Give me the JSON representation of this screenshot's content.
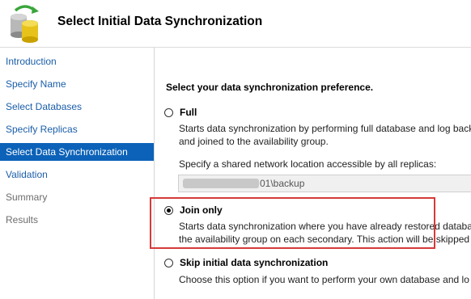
{
  "header": {
    "title": "Select Initial Data Synchronization",
    "icon": "database-sync-icon"
  },
  "sidebar": {
    "items": [
      {
        "label": "Introduction",
        "state": "link"
      },
      {
        "label": "Specify Name",
        "state": "link"
      },
      {
        "label": "Select Databases",
        "state": "link"
      },
      {
        "label": "Specify Replicas",
        "state": "link"
      },
      {
        "label": "Select Data Synchronization",
        "state": "selected"
      },
      {
        "label": "Validation",
        "state": "link"
      },
      {
        "label": "Summary",
        "state": "disabled"
      },
      {
        "label": "Results",
        "state": "disabled"
      }
    ]
  },
  "main": {
    "heading": "Select your data synchronization preference.",
    "options": [
      {
        "label": "Full",
        "checked": false,
        "desc_lines": [
          "Starts data synchronization by performing full database and log back",
          "and joined to the availability group."
        ]
      },
      {
        "label": "Join only",
        "checked": true,
        "desc_lines": [
          "Starts data synchronization where you have already restored database",
          "the availability group on each secondary. This action will be skipped f"
        ]
      },
      {
        "label": "Skip initial data synchronization",
        "checked": false,
        "desc_lines": [
          "Choose this option if you want to perform your own database and lo"
        ]
      }
    ],
    "network_location_label": "Specify a shared network location accessible by all replicas:",
    "network_location_value": "01\\backup"
  },
  "colors": {
    "selected_bg": "#0c62b8",
    "link": "#1a5ea8",
    "highlight": "#d63a3a"
  }
}
